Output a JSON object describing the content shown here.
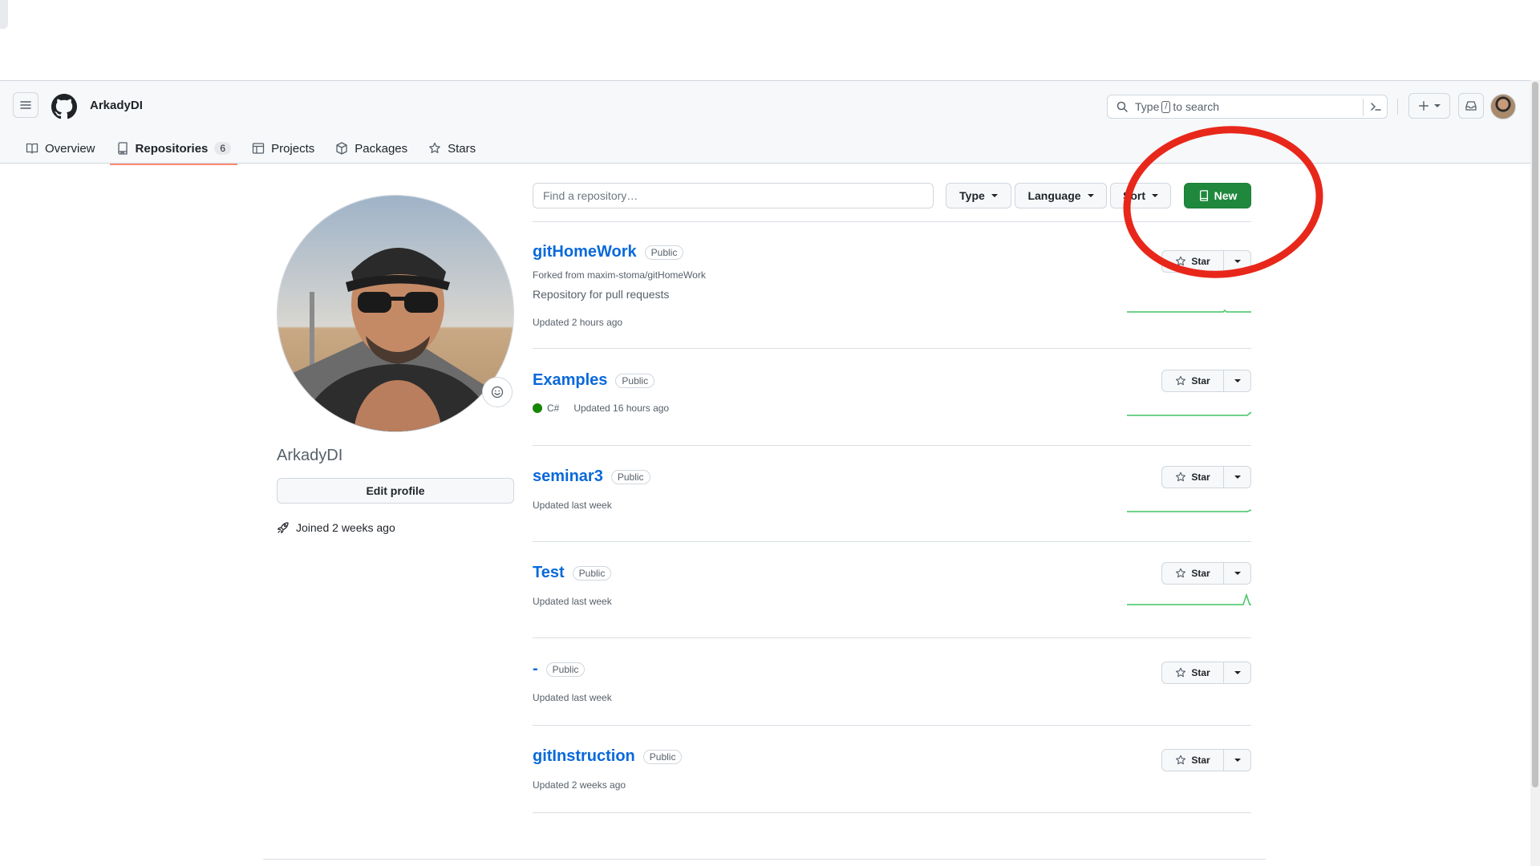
{
  "header": {
    "username": "ArkadyDI",
    "search": {
      "prefix": "Type",
      "kbd": "/",
      "suffix": "to search"
    },
    "tabs": [
      {
        "label": "Overview",
        "icon": "book-icon"
      },
      {
        "label": "Repositories",
        "icon": "repo-icon",
        "count": "6",
        "active": true
      },
      {
        "label": "Projects",
        "icon": "table-icon"
      },
      {
        "label": "Packages",
        "icon": "package-icon"
      },
      {
        "label": "Stars",
        "icon": "star-icon"
      }
    ]
  },
  "sidebar": {
    "name": "ArkadyDI",
    "edit_profile": "Edit profile",
    "joined": "Joined 2 weeks ago"
  },
  "filters": {
    "find_placeholder": "Find a repository…",
    "type": "Type",
    "language": "Language",
    "sort": "Sort",
    "new": "New"
  },
  "repos": [
    {
      "name": "gitHomeWork",
      "visibility": "Public",
      "forked": "Forked from maxim-stoma/gitHomeWork",
      "description": "Repository for pull requests",
      "updated": "Updated 2 hours ago",
      "star": "Star"
    },
    {
      "name": "Examples",
      "visibility": "Public",
      "language": "C#",
      "language_color": "#178600",
      "updated": "Updated 16 hours ago",
      "star": "Star"
    },
    {
      "name": "seminar3",
      "visibility": "Public",
      "updated": "Updated last week",
      "star": "Star"
    },
    {
      "name": "Test",
      "visibility": "Public",
      "updated": "Updated last week",
      "star": "Star"
    },
    {
      "name": "-",
      "visibility": "Public",
      "updated": "Updated last week",
      "star": "Star"
    },
    {
      "name": "gitInstruction",
      "visibility": "Public",
      "updated": "Updated 2 weeks ago",
      "star": "Star"
    }
  ],
  "colors": {
    "accent": "#0969da",
    "new_button": "#1f883d",
    "tab_underline": "#fd8c73",
    "annotation": "#e8271b"
  }
}
